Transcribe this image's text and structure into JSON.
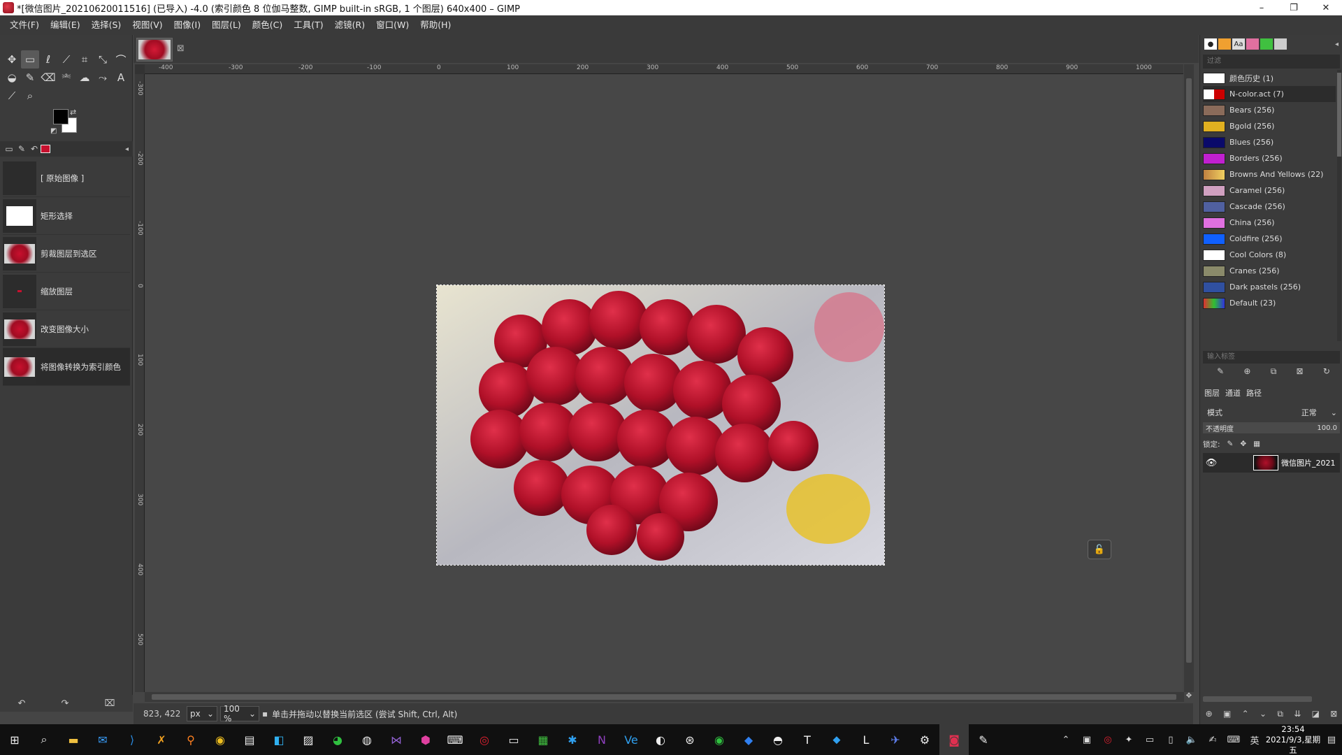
{
  "window": {
    "title": "*[微信图片_20210620011516] (已导入) -4.0 (索引颜色 8 位伽马整数, GIMP built-in sRGB, 1 个图层) 640x400 – GIMP",
    "minimize": "–",
    "maximize": "❐",
    "close": "✕"
  },
  "menu": [
    "文件(F)",
    "编辑(E)",
    "选择(S)",
    "视图(V)",
    "图像(I)",
    "图层(L)",
    "颜色(C)",
    "工具(T)",
    "滤镜(R)",
    "窗口(W)",
    "帮助(H)"
  ],
  "tools": [
    {
      "icon": "move-icon",
      "glyph": "✥"
    },
    {
      "icon": "rect-select-icon",
      "glyph": "▭"
    },
    {
      "icon": "lasso-icon",
      "glyph": "ℓ"
    },
    {
      "icon": "fuzzy-select-icon",
      "glyph": "⟋"
    },
    {
      "icon": "crop-icon",
      "glyph": "⌗"
    },
    {
      "icon": "transform-icon",
      "glyph": "⤡"
    },
    {
      "icon": "warp-icon",
      "glyph": "⌒"
    },
    {
      "icon": "bucket-fill-icon",
      "glyph": "◒"
    },
    {
      "icon": "paintbrush-icon",
      "glyph": "✎"
    },
    {
      "icon": "eraser-icon",
      "glyph": "⌫"
    },
    {
      "icon": "clone-icon",
      "glyph": "⎃"
    },
    {
      "icon": "smudge-icon",
      "glyph": "☁"
    },
    {
      "icon": "paths-icon",
      "glyph": "⤳"
    },
    {
      "icon": "text-icon",
      "glyph": "A"
    },
    {
      "icon": "color-picker-icon",
      "glyph": "⟋"
    },
    {
      "icon": "zoom-icon",
      "glyph": "⌕"
    }
  ],
  "undo_history": [
    {
      "label": "[ 原始图像 ]",
      "thumb": "empty"
    },
    {
      "label": "矩形选择",
      "thumb": "white"
    },
    {
      "label": "剪裁图层到选区",
      "thumb": "image"
    },
    {
      "label": "缩放图层",
      "thumb": "tiny"
    },
    {
      "label": "改变图像大小",
      "thumb": "image"
    },
    {
      "label": "将图像转换为索引颜色",
      "thumb": "image"
    }
  ],
  "rulers": {
    "horizontal": [
      "-400",
      "-300",
      "-200",
      "-100",
      "0",
      "100",
      "200",
      "300",
      "400",
      "500",
      "600",
      "700",
      "800",
      "900",
      "1000"
    ],
    "vertical": [
      "-300",
      "-200",
      "-100",
      "0",
      "100",
      "200",
      "300",
      "400",
      "500",
      "600"
    ]
  },
  "status": {
    "coords": "823, 422",
    "unit": "px",
    "zoom": "100 %",
    "message": "单击并拖动以替换当前选区 (尝试 Shift, Ctrl, Alt)"
  },
  "palettes": {
    "filter_placeholder": "过滤",
    "tag_placeholder": "输入标签",
    "items": [
      {
        "name": "颜色历史 (1)",
        "swatch": "#ffffff"
      },
      {
        "name": "N-color.act (7)",
        "swatch": "#ffffff"
      },
      {
        "name": "Bears (256)",
        "swatch": "#8a6b5a"
      },
      {
        "name": "Bgold (256)",
        "swatch": "#e0b020"
      },
      {
        "name": "Blues (256)",
        "swatch": "#0a0a6a"
      },
      {
        "name": "Borders (256)",
        "swatch": "#c020d0"
      },
      {
        "name": "Browns And Yellows (22)",
        "swatch": "#c08040"
      },
      {
        "name": "Caramel (256)",
        "swatch": "#d0a0c0"
      },
      {
        "name": "Cascade (256)",
        "swatch": "#5060a0"
      },
      {
        "name": "China (256)",
        "swatch": "#e070e0"
      },
      {
        "name": "Coldfire (256)",
        "swatch": "#1060ff"
      },
      {
        "name": "Cool Colors (8)",
        "swatch": "#ffffff"
      },
      {
        "name": "Cranes (256)",
        "swatch": "#8a8a6a"
      },
      {
        "name": "Dark pastels (256)",
        "swatch": "#3050a0"
      },
      {
        "name": "Default (23)",
        "swatch": "#e03030"
      }
    ]
  },
  "layers": {
    "tabs": [
      "图层",
      "通道",
      "路径"
    ],
    "mode_label": "模式",
    "mode_value": "正常",
    "opacity_label": "不透明度",
    "opacity_value": "100.0",
    "lock_label": "锁定:",
    "layer_name": "微信图片_2021"
  },
  "taskbar": {
    "time": "23:54",
    "date": "2021/9/3,星期五",
    "ime": "英"
  }
}
